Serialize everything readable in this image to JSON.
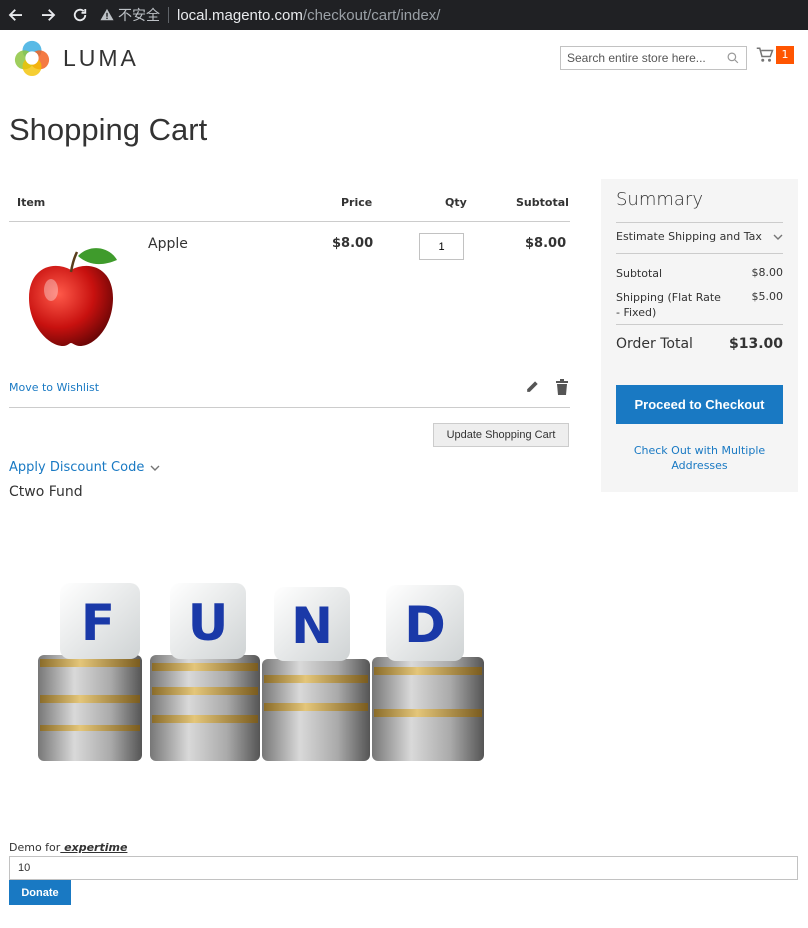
{
  "browser": {
    "security_label": "不安全",
    "url_host": "local.magento.com",
    "url_path": "/checkout/cart/index/"
  },
  "header": {
    "logo_text": "LUMA",
    "search_placeholder": "Search entire store here...",
    "cart_count": "1"
  },
  "page_title": "Shopping Cart",
  "cart": {
    "columns": [
      "Item",
      "Price",
      "Qty",
      "Subtotal"
    ],
    "item": {
      "name": "Apple",
      "price": "$8.00",
      "qty": "1",
      "subtotal": "$8.00"
    },
    "move_to_wishlist": "Move to Wishlist",
    "update_label": "Update Shopping Cart"
  },
  "discount_label": "Apply Discount Code",
  "fund": {
    "title": "Ctwo Fund",
    "letters": [
      "F",
      "U",
      "N",
      "D"
    ],
    "demo_prefix": "Demo for",
    "demo_link": " expertime ",
    "amount": "10",
    "donate_label": "Donate"
  },
  "summary": {
    "title": "Summary",
    "estimate_label": "Estimate Shipping and Tax",
    "subtotal_label": "Subtotal",
    "subtotal_value": "$8.00",
    "shipping_label": "Shipping (Flat Rate - Fixed)",
    "shipping_value": "$5.00",
    "total_label": "Order Total",
    "total_value": "$13.00",
    "checkout_label": "Proceed to Checkout",
    "multi_label": "Check Out with Multiple Addresses"
  },
  "colors": {
    "accent": "#1979c3",
    "counter": "#ff5501"
  }
}
